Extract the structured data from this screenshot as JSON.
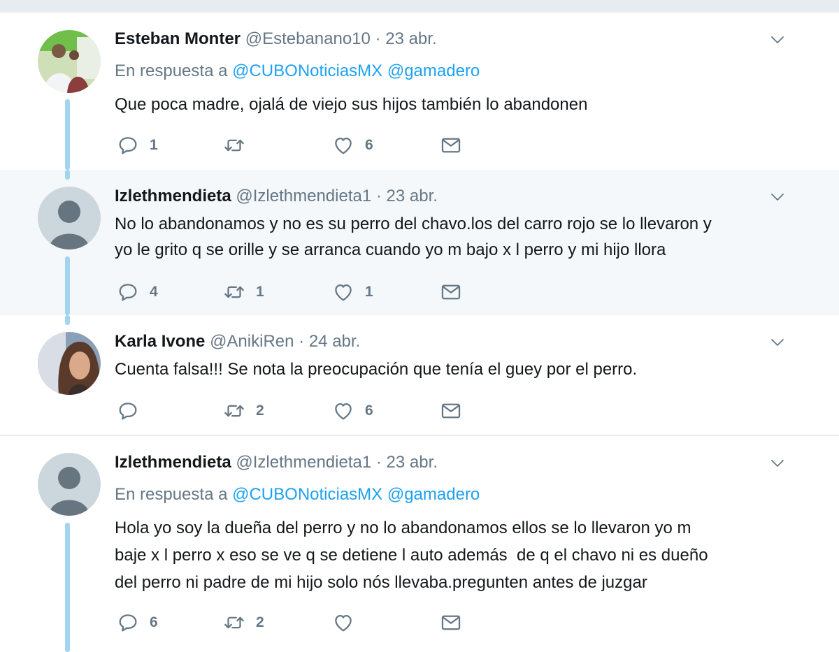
{
  "tweets": [
    {
      "name": "Esteban Monter",
      "handle": "@Estebanano10",
      "separator": "·",
      "date": "23 abr.",
      "reply_prefix": "En respuesta a",
      "reply_mentions": [
        "@CUBONoticiasMX",
        "@gamadero"
      ],
      "text": "Que poca madre, ojalá de viejo sus hijos también lo abandonen",
      "replies": "1",
      "retweets": "",
      "likes": "6"
    },
    {
      "name": "Izlethmendieta",
      "handle": "@Izlethmendieta1",
      "separator": "·",
      "date": "23 abr.",
      "text": "No lo abandonamos y no es su perro del chavo.los del carro rojo se lo llevaron y\nyo le grito q se orille y se arranca cuando yo m bajo x l perro y mi hijo llora",
      "replies": "4",
      "retweets": "1",
      "likes": "1"
    },
    {
      "name": "Karla Ivone",
      "handle": "@AnikiRen",
      "separator": "·",
      "date": "24 abr.",
      "text": "Cuenta falsa!!! Se nota la preocupación que tenía el guey por el perro.",
      "replies": "",
      "retweets": "2",
      "likes": "6"
    },
    {
      "name": "Izlethmendieta",
      "handle": "@Izlethmendieta1",
      "separator": "·",
      "date": "23 abr.",
      "reply_prefix": "En respuesta a",
      "reply_mentions": [
        "@CUBONoticiasMX",
        "@gamadero"
      ],
      "text": "Hola yo soy la dueña del perro y no lo abandonamos ellos se lo llevaron yo m\nbaje x l perro x eso se ve q se detiene l auto además  de q el chavo ni es dueño\ndel perro ni padre de mi hijo solo nós llevaba.pregunten antes de juzgar",
      "replies": "6",
      "retweets": "2",
      "likes": ""
    }
  ],
  "icons": {
    "reply": "reply-bubble-icon",
    "retweet": "retweet-icon",
    "like": "heart-icon",
    "dm": "envelope-icon",
    "menu": "chevron-down-icon"
  },
  "colors": {
    "mention": "#1da1f2",
    "secondary_text": "#657786",
    "thread_line": "#a3d4f0",
    "highlight_bg": "#f5f8fa",
    "divider": "#e6ecf0"
  }
}
